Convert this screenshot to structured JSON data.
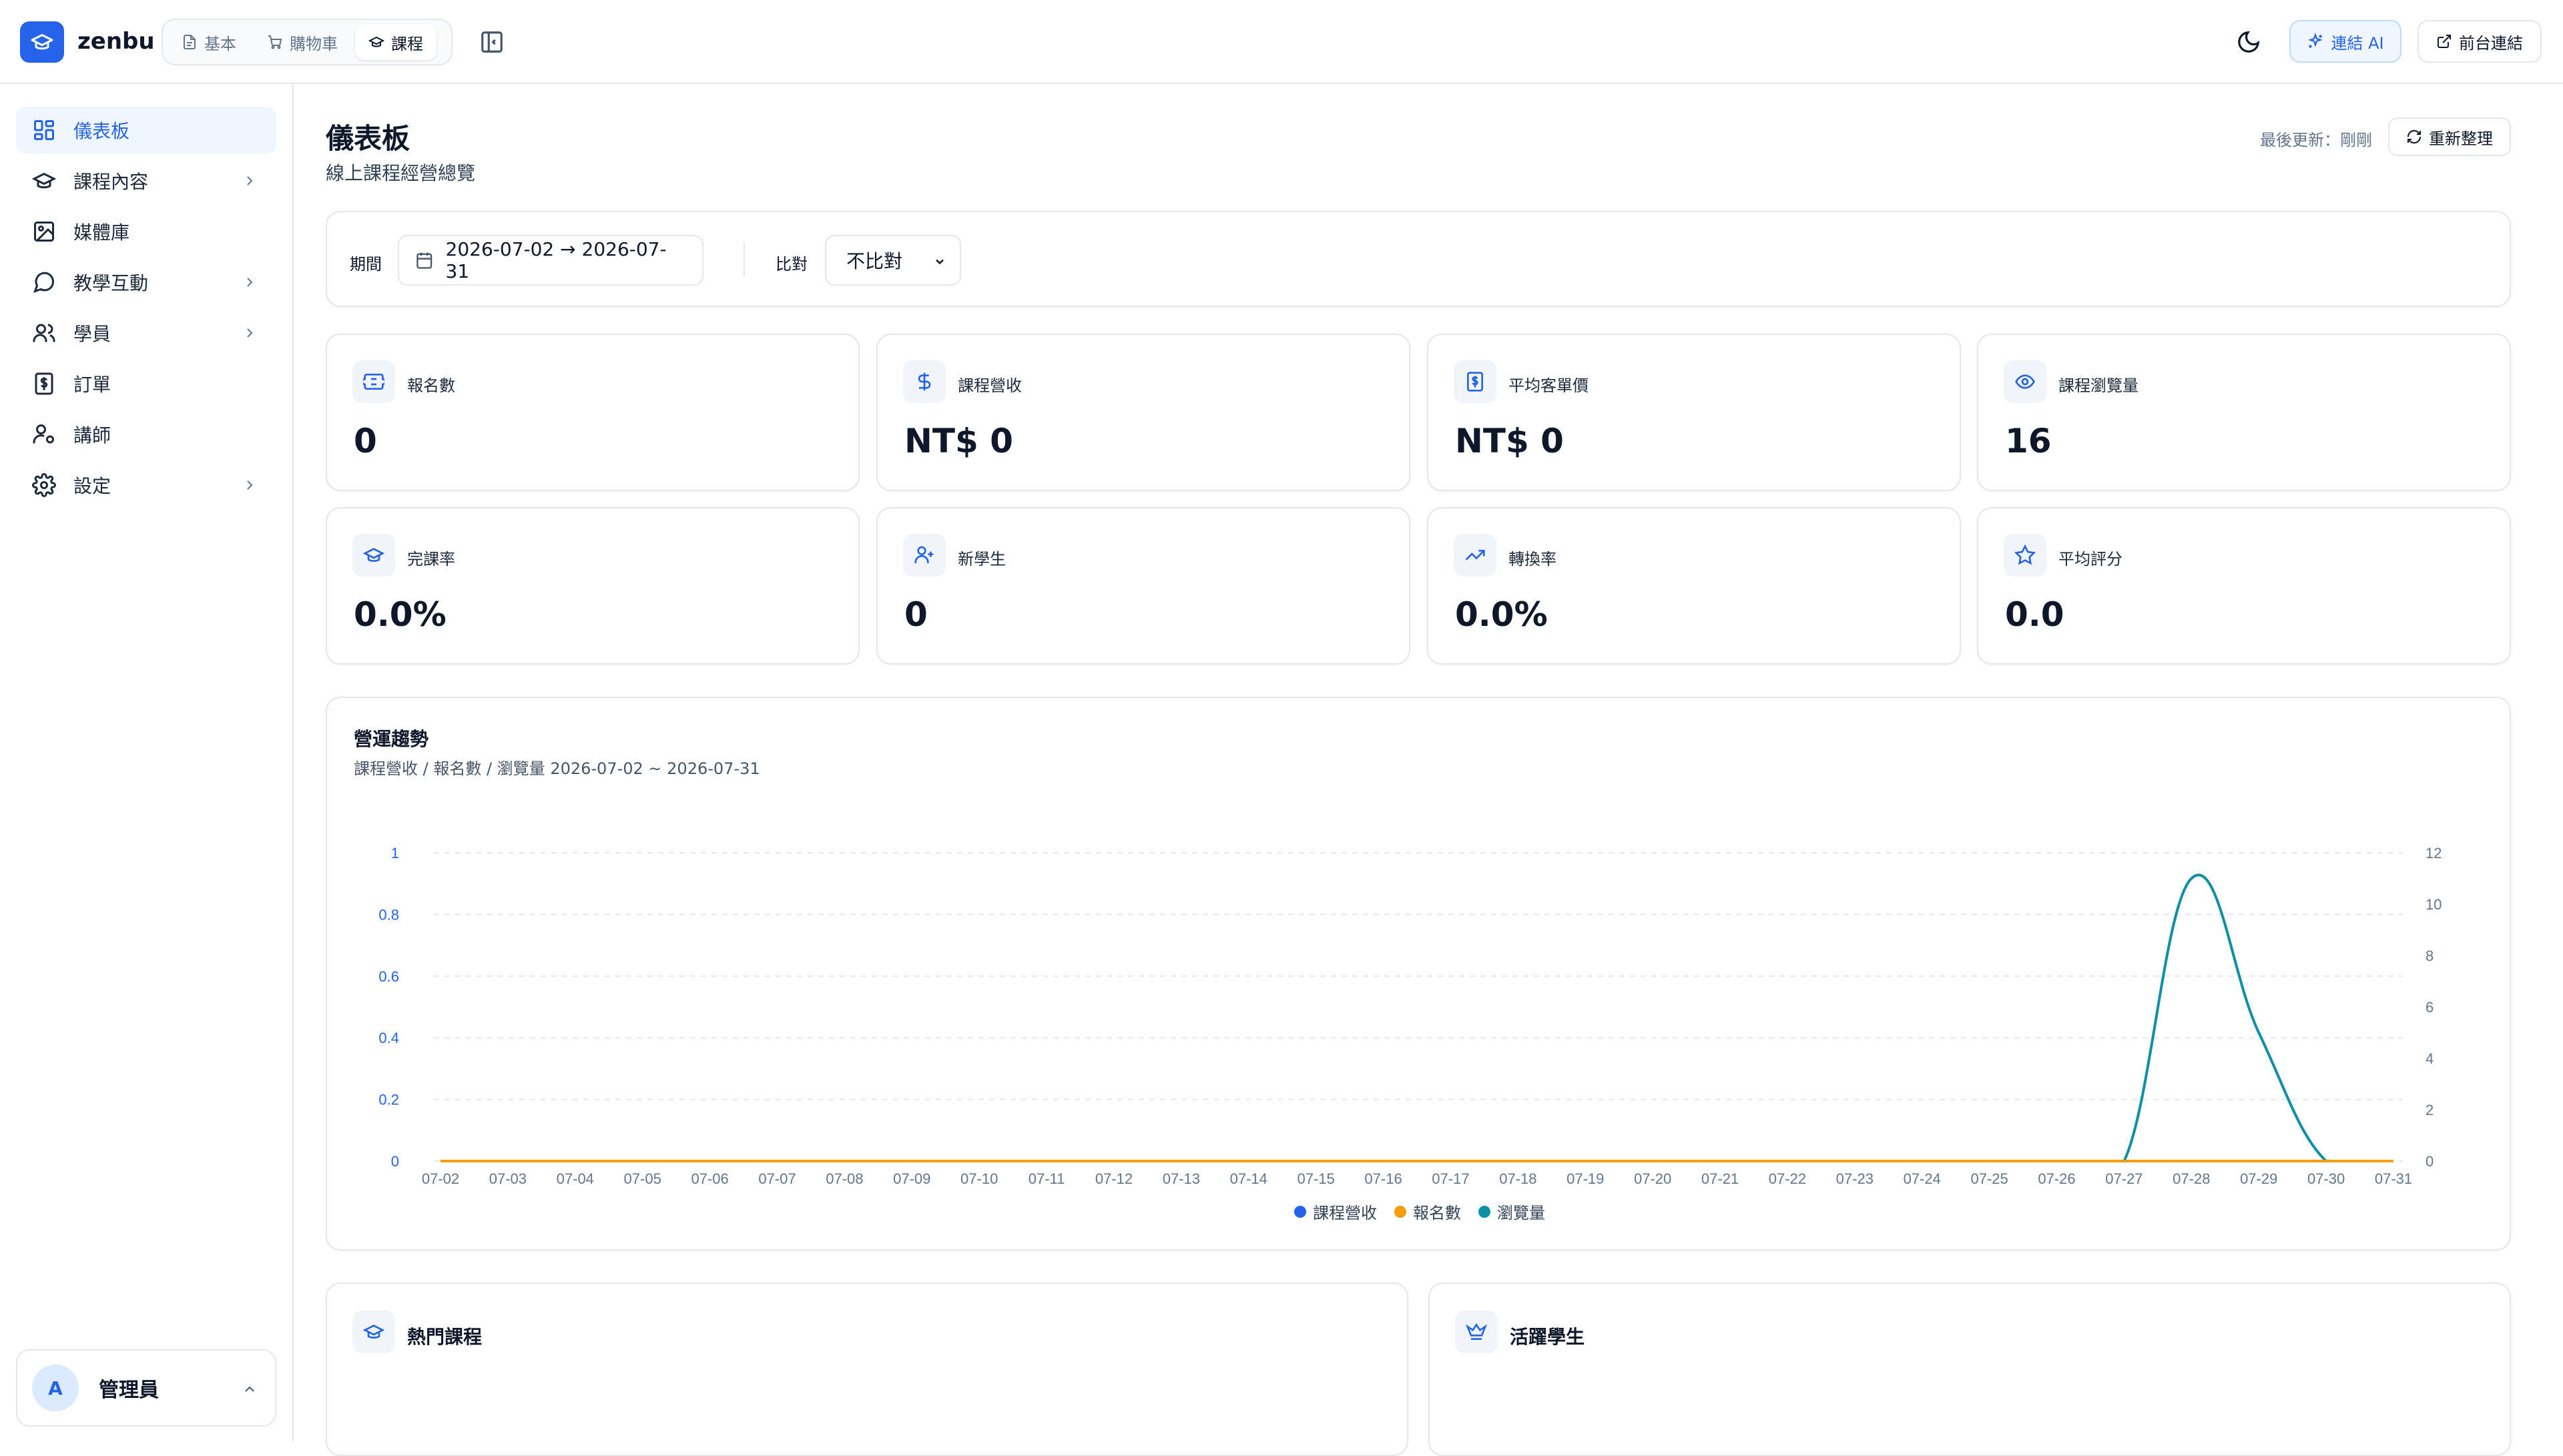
{
  "app": {
    "brand": "zenbu"
  },
  "top_tabs": [
    {
      "label": "基本",
      "icon": "file-icon"
    },
    {
      "label": "購物車",
      "icon": "cart-icon"
    },
    {
      "label": "課程",
      "icon": "graduation-cap-icon",
      "active": true
    }
  ],
  "header": {
    "ai_button": "連結 AI",
    "front_button": "前台連結"
  },
  "sidebar": {
    "items": [
      {
        "label": "儀表板",
        "icon": "dashboard-icon",
        "active": true,
        "has_children": false
      },
      {
        "label": "課程內容",
        "icon": "graduation-cap-icon",
        "has_children": true
      },
      {
        "label": "媒體庫",
        "icon": "image-icon",
        "has_children": false
      },
      {
        "label": "教學互動",
        "icon": "message-icon",
        "has_children": true
      },
      {
        "label": "學員",
        "icon": "users-icon",
        "has_children": true
      },
      {
        "label": "訂單",
        "icon": "receipt-icon",
        "has_children": false
      },
      {
        "label": "講師",
        "icon": "user-cog-icon",
        "has_children": false
      },
      {
        "label": "設定",
        "icon": "gear-icon",
        "has_children": true
      }
    ],
    "user": {
      "initial": "A",
      "name": "管理員"
    }
  },
  "page": {
    "title": "儀表板",
    "subtitle": "線上課程經營總覽",
    "last_updated": "最後更新：剛剛",
    "refresh_label": "重新整理"
  },
  "filters": {
    "period_label": "期間",
    "date_range": "2026-07-02 → 2026-07-31",
    "compare_label": "比對",
    "compare_value": "不比對"
  },
  "stats": [
    {
      "label": "報名數",
      "value": "0",
      "icon": "ticket-icon"
    },
    {
      "label": "課程營收",
      "value": "NT$ 0",
      "icon": "dollar-icon"
    },
    {
      "label": "平均客單價",
      "value": "NT$ 0",
      "icon": "receipt-icon"
    },
    {
      "label": "課程瀏覽量",
      "value": "16",
      "icon": "eye-icon"
    },
    {
      "label": "完課率",
      "value": "0.0%",
      "icon": "graduation-cap-icon"
    },
    {
      "label": "新學生",
      "value": "0",
      "icon": "user-plus-icon"
    },
    {
      "label": "轉換率",
      "value": "0.0%",
      "icon": "trending-up-icon"
    },
    {
      "label": "平均評分",
      "value": "0.0",
      "icon": "star-icon"
    }
  ],
  "chart_data": {
    "type": "line",
    "title": "營運趨勢",
    "subtitle": "課程營收 / 報名數 / 瀏覽量  2026-07-02 ~ 2026-07-31",
    "categories": [
      "07-02",
      "07-03",
      "07-04",
      "07-05",
      "07-06",
      "07-07",
      "07-08",
      "07-09",
      "07-10",
      "07-11",
      "07-12",
      "07-13",
      "07-14",
      "07-15",
      "07-16",
      "07-17",
      "07-18",
      "07-19",
      "07-20",
      "07-21",
      "07-22",
      "07-23",
      "07-24",
      "07-25",
      "07-26",
      "07-27",
      "07-28",
      "07-29",
      "07-30",
      "07-31"
    ],
    "y_left": {
      "ticks": [
        "0",
        "0.2",
        "0.4",
        "0.6",
        "0.8",
        "1"
      ],
      "range": [
        0,
        1
      ]
    },
    "y_right": {
      "ticks": [
        "0",
        "2",
        "4",
        "6",
        "8",
        "10",
        "12"
      ],
      "range": [
        0,
        12
      ]
    },
    "grid": true,
    "legend_position": "bottom",
    "series": [
      {
        "name": "課程營收",
        "axis": "left",
        "color": "#2563eb",
        "values": [
          0,
          0,
          0,
          0,
          0,
          0,
          0,
          0,
          0,
          0,
          0,
          0,
          0,
          0,
          0,
          0,
          0,
          0,
          0,
          0,
          0,
          0,
          0,
          0,
          0,
          0,
          0,
          0,
          0,
          0
        ]
      },
      {
        "name": "報名數",
        "axis": "left",
        "color": "#f59e0b",
        "values": [
          0,
          0,
          0,
          0,
          0,
          0,
          0,
          0,
          0,
          0,
          0,
          0,
          0,
          0,
          0,
          0,
          0,
          0,
          0,
          0,
          0,
          0,
          0,
          0,
          0,
          0,
          0,
          0,
          0,
          0
        ]
      },
      {
        "name": "瀏覽量",
        "axis": "right",
        "color": "#0e8fa3",
        "values": [
          0,
          0,
          0,
          0,
          0,
          0,
          0,
          0,
          0,
          0,
          0,
          0,
          0,
          0,
          0,
          0,
          0,
          0,
          0,
          0,
          0,
          0,
          0,
          0,
          0,
          0,
          11,
          5,
          0,
          0
        ]
      }
    ]
  },
  "bottom_cards": [
    {
      "title": "熱門課程",
      "icon": "graduation-cap-icon"
    },
    {
      "title": "活躍學生",
      "icon": "crown-icon"
    }
  ]
}
